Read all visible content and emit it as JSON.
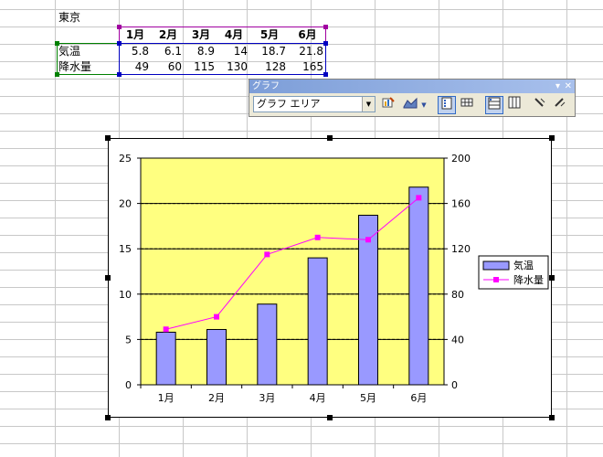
{
  "sheet": {
    "title": "東京",
    "months": [
      "1月",
      "2月",
      "3月",
      "4月",
      "5月",
      "6月"
    ],
    "rows": [
      {
        "label": "気温",
        "values": [
          "5.8",
          "6.1",
          "8.9",
          "14",
          "18.7",
          "21.8"
        ]
      },
      {
        "label": "降水量",
        "values": [
          "49",
          "60",
          "115",
          "130",
          "128",
          "165"
        ]
      }
    ]
  },
  "toolbar": {
    "title": "グラフ",
    "menu_arrow": "▾",
    "close": "✕",
    "element_select": "グラフ エリア",
    "select_arrow": "▼"
  },
  "chart_data": {
    "type": "bar",
    "categories": [
      "1月",
      "2月",
      "3月",
      "4月",
      "5月",
      "6月"
    ],
    "series": [
      {
        "name": "気温",
        "type": "bar",
        "axis": "left",
        "values": [
          5.8,
          6.1,
          8.9,
          14,
          18.7,
          21.8
        ],
        "color": "#9999ff"
      },
      {
        "name": "降水量",
        "type": "line",
        "axis": "right",
        "values": [
          49,
          60,
          115,
          130,
          128,
          165
        ],
        "color": "#ff00ff"
      }
    ],
    "y_left": {
      "min": 0,
      "max": 25,
      "ticks": [
        "0",
        "5",
        "10",
        "15",
        "20",
        "25"
      ]
    },
    "y_right": {
      "min": 0,
      "max": 200,
      "ticks": [
        "0",
        "40",
        "80",
        "120",
        "160",
        "200"
      ]
    },
    "plot_background": "#ffff80",
    "grid": true,
    "legend_position": "right"
  }
}
